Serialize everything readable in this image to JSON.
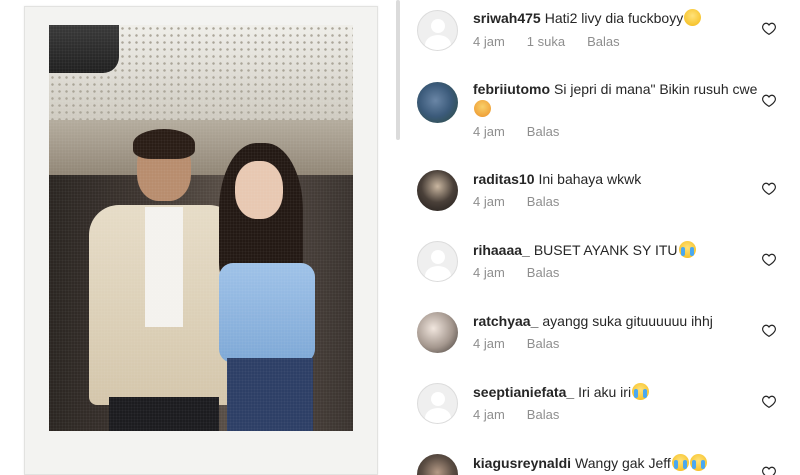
{
  "photo": {
    "alt": ""
  },
  "comments": [
    {
      "username": "sriwah475",
      "text": "Hati2 livy dia fuckboyy",
      "emoji": "grinning-sweat",
      "time": "4 jam",
      "likes": "1 suka",
      "reply": "Balas",
      "avatar": "default"
    },
    {
      "username": "febriiutomo",
      "text": "Si jepri di mana\" Bikin rusuh cwe",
      "emoji": "angry",
      "time": "4 jam",
      "likes": "",
      "reply": "Balas",
      "avatar": "photo"
    },
    {
      "username": "raditas10",
      "text": "Ini bahaya wkwk",
      "emoji": "",
      "time": "4 jam",
      "likes": "",
      "reply": "Balas",
      "avatar": "photo"
    },
    {
      "username": "rihaaaa_",
      "text": "BUSET AYANK SY ITU",
      "emoji": "loudly-crying",
      "time": "4 jam",
      "likes": "",
      "reply": "Balas",
      "avatar": "default"
    },
    {
      "username": "ratchyaa_",
      "text": "ayangg suka gituuuuuu ihhj",
      "emoji": "",
      "time": "4 jam",
      "likes": "",
      "reply": "Balas",
      "avatar": "photo"
    },
    {
      "username": "seeptianiefata_",
      "text": "Iri aku iri",
      "emoji": "loudly-crying",
      "time": "4 jam",
      "likes": "",
      "reply": "Balas",
      "avatar": "default"
    },
    {
      "username": "kiagusreynaldi",
      "text": "Wangy gak Jeff",
      "emoji": "loudly-crying-x2",
      "time": "",
      "likes": "",
      "reply": "",
      "avatar": "photo"
    }
  ]
}
